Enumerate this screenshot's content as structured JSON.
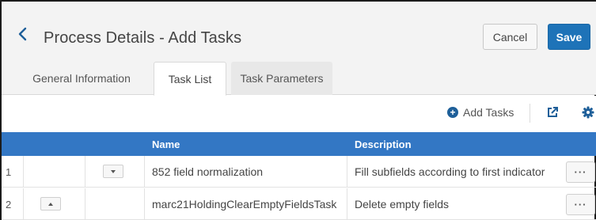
{
  "header": {
    "title": "Process Details - Add Tasks",
    "cancel_label": "Cancel",
    "save_label": "Save",
    "accent_color": "#1e73b8"
  },
  "tabs": [
    {
      "label": "General Information",
      "active": false
    },
    {
      "label": "Task List",
      "active": true
    },
    {
      "label": "Task Parameters",
      "active": false
    }
  ],
  "toolbar": {
    "add_tasks_label": "Add Tasks",
    "icons": [
      "plus-circle-icon",
      "export-icon",
      "gear-icon"
    ]
  },
  "table": {
    "header_color": "#3377c4",
    "columns": [
      "Name",
      "Description"
    ],
    "rows": [
      {
        "num": "1",
        "name": "852 field normalization",
        "description": "Fill subfields according to first indicator",
        "more": "···"
      },
      {
        "num": "2",
        "name": "marc21HoldingClearEmptyFieldsTask",
        "description": "Delete empty fields",
        "more": "···"
      }
    ]
  }
}
